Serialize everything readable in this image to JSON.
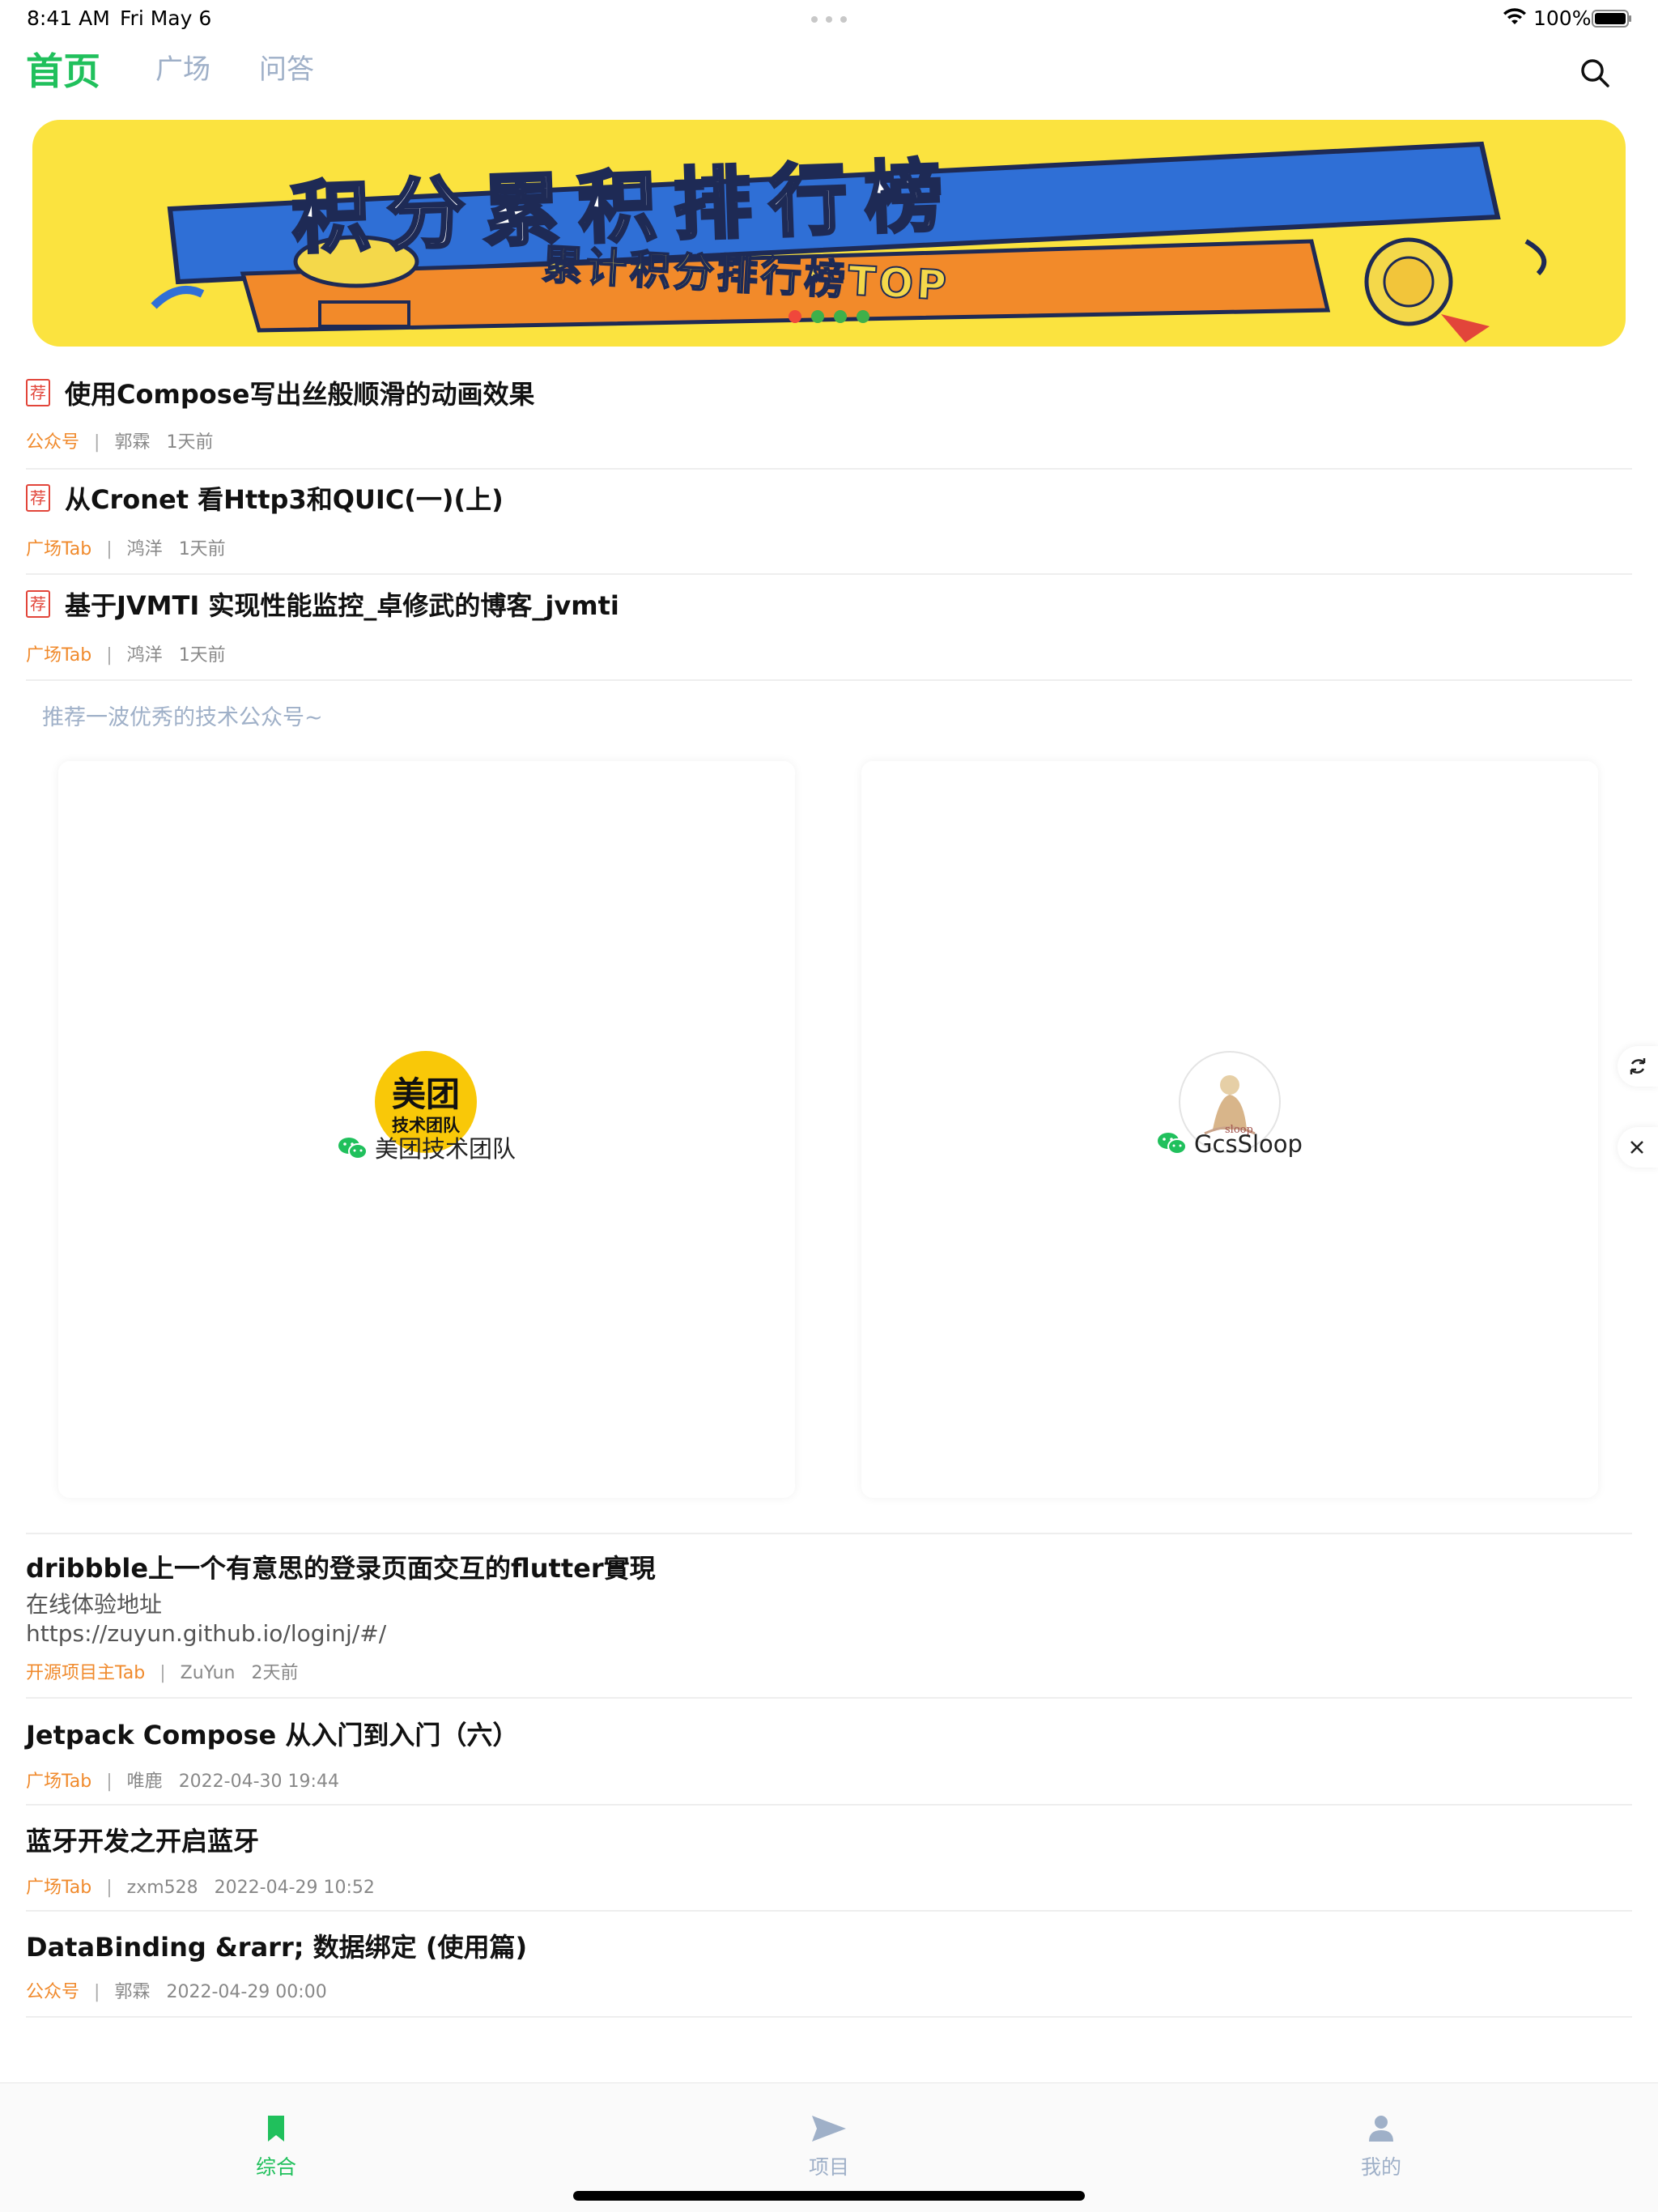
{
  "status_bar": {
    "time": "8:41 AM",
    "date": "Fri May 6",
    "battery": "100%"
  },
  "top_nav": {
    "tabs": [
      {
        "label": "首页",
        "active": true
      },
      {
        "label": "广场",
        "active": false
      },
      {
        "label": "问答",
        "active": false
      }
    ],
    "search_icon": "search-icon"
  },
  "banner": {
    "title": "积分累积排行榜",
    "subtitle": "累计积分排行榜TOP",
    "dots": 4,
    "active_dot": 0
  },
  "top_articles": [
    {
      "badge": "荐",
      "title": "使用Compose写出丝般顺滑的动画效果",
      "chapter": "公众号",
      "author": "郭霖",
      "time": "1天前"
    },
    {
      "badge": "荐",
      "title": "从Cronet 看Http3和QUIC(一)(上)",
      "chapter": "广场Tab",
      "author": "鸿洋",
      "time": "1天前"
    },
    {
      "badge": "荐",
      "title": "基于JVMTI 实现性能监控_卓修武的博客_jvmti",
      "chapter": "广场Tab",
      "author": "鸿洋",
      "time": "1天前"
    }
  ],
  "recommend": {
    "title": "推荐一波优秀的技术公众号~",
    "accounts": [
      {
        "name": "美团技术团队",
        "avatar_text_1": "美团",
        "avatar_text_2": "技术团队"
      },
      {
        "name": "GcsSloop",
        "avatar_text_1": "sloop"
      }
    ]
  },
  "articles": [
    {
      "title": "dribbble上一个有意思的登录页面交互的flutter實現",
      "desc_1": "在线体验地址",
      "desc_2": "https://zuyun.github.io/loginj/#/",
      "chapter": "开源项目主Tab",
      "author": "ZuYun",
      "time": "2天前"
    },
    {
      "title": "Jetpack Compose 从入门到入门（六）",
      "chapter": "广场Tab",
      "author": "唯鹿",
      "time": "2022-04-30 19:44"
    },
    {
      "title": "蓝牙开发之开启蓝牙",
      "chapter": "广场Tab",
      "author": "zxm528",
      "time": "2022-04-29 10:52"
    },
    {
      "title": "DataBinding &rarr; 数据绑定 (使用篇)",
      "chapter": "公众号",
      "author": "郭霖",
      "time": "2022-04-29 00:00"
    }
  ],
  "separator": "|",
  "tabbar": [
    {
      "label": "综合",
      "icon": "bookmark-icon",
      "active": true
    },
    {
      "label": "项目",
      "icon": "send-icon",
      "active": false
    },
    {
      "label": "我的",
      "icon": "person-icon",
      "active": false
    }
  ],
  "colors": {
    "accent": "#20c05c",
    "chapter": "#f08a2c",
    "badge": "#e2453a",
    "muted": "#9fb0c8",
    "banner_bg": "#fbe33f"
  }
}
